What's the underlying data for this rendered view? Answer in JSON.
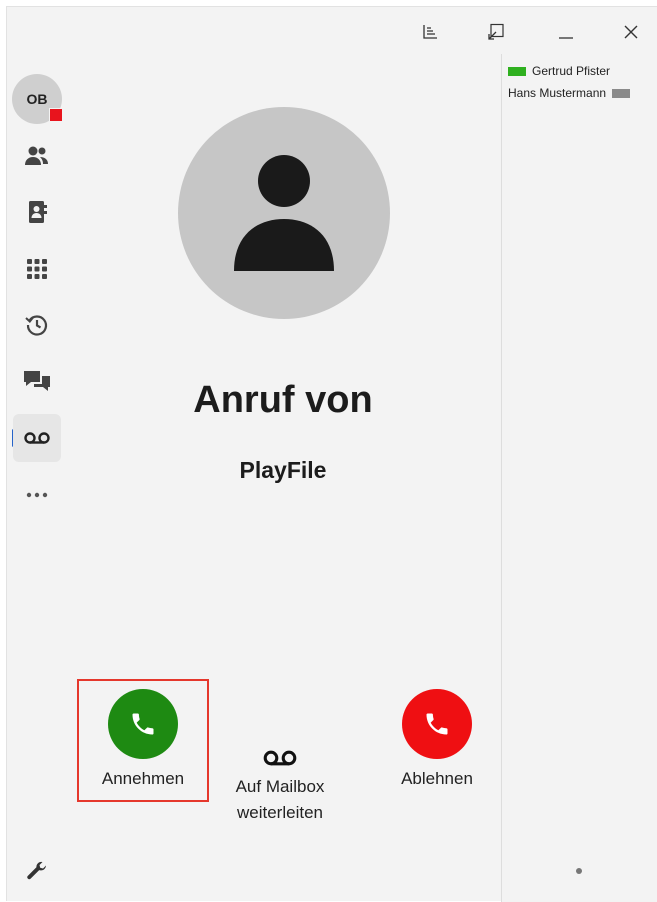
{
  "titlebar": {
    "icons": [
      "chart-icon",
      "popout-icon",
      "minimize-icon",
      "close-icon"
    ]
  },
  "nav": {
    "user_initials": "OB",
    "presence_color": "#e8141d",
    "items": [
      {
        "name": "contacts-icon"
      },
      {
        "name": "phonebook-icon"
      },
      {
        "name": "dialpad-icon"
      },
      {
        "name": "history-icon"
      },
      {
        "name": "chat-icon"
      },
      {
        "name": "voicemail-icon",
        "active": true
      },
      {
        "name": "more-icon"
      }
    ],
    "settings_icon": "wrench-icon",
    "active_indicator_color": "#2563c9"
  },
  "call": {
    "title": "Anruf von",
    "caller": "PlayFile",
    "accept_label": "Annehmen",
    "mailbox_label_line1": "Auf Mailbox",
    "mailbox_label_line2": "weiterleiten",
    "decline_label": "Ablehnen",
    "accept_color": "#1e8a12",
    "decline_color": "#ef0f12",
    "highlight_color": "#e5372c"
  },
  "panel": {
    "contacts": [
      {
        "name": "Gertrud Pfister",
        "status_color": "#2fb01f"
      },
      {
        "name": "Hans Mustermann",
        "status_color": "#8a8a8a"
      }
    ]
  }
}
